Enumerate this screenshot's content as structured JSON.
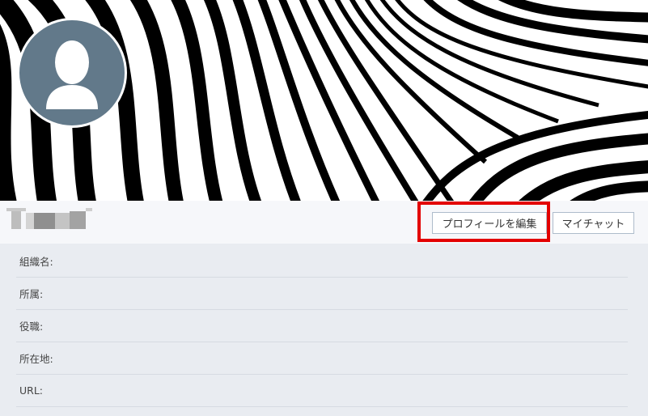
{
  "cover": {
    "alt": "black and white wavy striped cover image"
  },
  "avatar": {
    "icon": "user-silhouette-icon"
  },
  "profile": {
    "name_redacted": ""
  },
  "actions": {
    "edit_profile_label": "プロフィールを編集",
    "my_chat_label": "マイチャット"
  },
  "details": {
    "rows": [
      {
        "label": "組織名:",
        "value": ""
      },
      {
        "label": "所属:",
        "value": ""
      },
      {
        "label": "役職:",
        "value": ""
      },
      {
        "label": "所在地:",
        "value": ""
      },
      {
        "label": "URL:",
        "value": ""
      }
    ]
  },
  "colors": {
    "highlight": "#e30000",
    "avatar_bg": "#62798a",
    "page_bg": "#e9ecf1",
    "bar_bg": "#f6f7fa"
  }
}
